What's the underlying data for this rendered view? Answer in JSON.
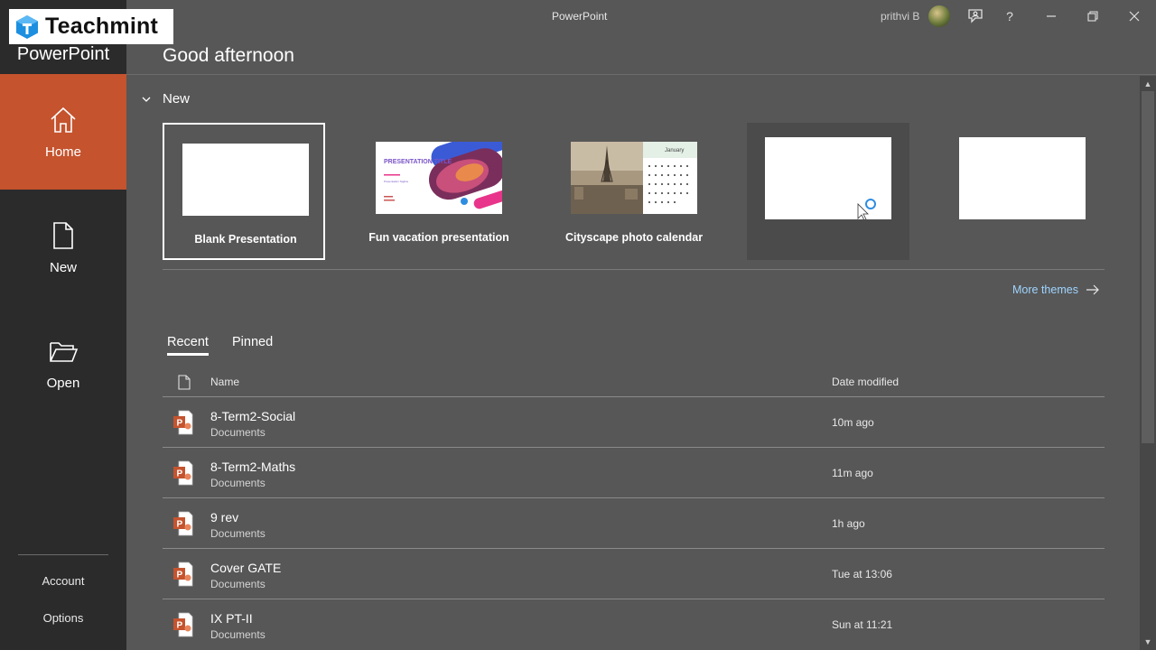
{
  "brand": {
    "logo_text": "Teachmint",
    "app_name": "PowerPoint"
  },
  "titlebar": {
    "title": "PowerPoint",
    "user": "prithvi B",
    "help": "?"
  },
  "nav": {
    "home": "Home",
    "new": "New",
    "open": "Open",
    "account": "Account",
    "options": "Options"
  },
  "greeting": "Good afternoon",
  "new_section": {
    "label": "New",
    "templates": [
      {
        "name": "Blank Presentation"
      },
      {
        "name": "Fun vacation presentation",
        "thumb_title": "PRESENTATION TITLE",
        "thumb_sub": "Presentation Tagline"
      },
      {
        "name": "Cityscape photo calendar",
        "thumb_month": "January"
      },
      {
        "name": ""
      },
      {
        "name": ""
      }
    ],
    "more_themes": "More themes"
  },
  "tabs": {
    "recent": "Recent",
    "pinned": "Pinned"
  },
  "columns": {
    "name": "Name",
    "date": "Date modified"
  },
  "files": [
    {
      "name": "8-Term2-Social",
      "location": "Documents",
      "modified": "10m ago"
    },
    {
      "name": "8-Term2-Maths",
      "location": "Documents",
      "modified": "11m ago"
    },
    {
      "name": "9 rev",
      "location": "Documents",
      "modified": "1h ago"
    },
    {
      "name": "Cover GATE",
      "location": "Documents",
      "modified": "Tue at 13:06"
    },
    {
      "name": "IX PT-II",
      "location": "Documents",
      "modified": "Sun at 11:21"
    }
  ],
  "colors": {
    "accent": "#c4532e",
    "rail": "#2b2b2b",
    "background": "#575757",
    "link": "#9fd4ff"
  }
}
